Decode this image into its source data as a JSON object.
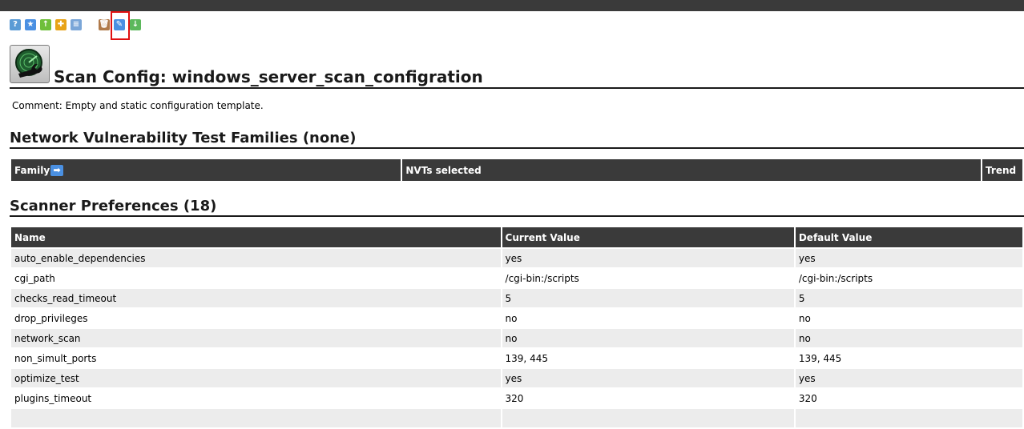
{
  "toolbar": {
    "icons": [
      {
        "name": "help-icon",
        "glyph": "?",
        "color": "#5b9bd5"
      },
      {
        "name": "star-icon",
        "glyph": "★",
        "color": "#4a90e2"
      },
      {
        "name": "up-arrow-icon",
        "glyph": "↑",
        "color": "#6fbf3a"
      },
      {
        "name": "new-config-icon",
        "glyph": "✚",
        "color": "#e8a317"
      },
      {
        "name": "list-icon",
        "glyph": "≡",
        "color": "#7aa6d8"
      },
      {
        "name": "trashcan-icon",
        "glyph": "🗑",
        "color": "#b07a4a"
      },
      {
        "name": "edit-icon",
        "glyph": "✎",
        "color": "#4a90e2"
      },
      {
        "name": "download-icon",
        "glyph": "↓",
        "color": "#5cb85c"
      }
    ]
  },
  "page": {
    "title": "Scan Config: windows_server_scan_configration",
    "comment": "Comment: Empty and static configuration template."
  },
  "families": {
    "heading": "Network Vulnerability Test Families (none)",
    "columns": [
      "Family",
      "NVTs selected",
      "Trend"
    ]
  },
  "scanner_prefs": {
    "heading": "Scanner Preferences (18)",
    "columns": [
      "Name",
      "Current Value",
      "Default Value"
    ],
    "rows": [
      {
        "name": "auto_enable_dependencies",
        "current": "yes",
        "default": "yes"
      },
      {
        "name": "cgi_path",
        "current": "/cgi-bin:/scripts",
        "default": "/cgi-bin:/scripts"
      },
      {
        "name": "checks_read_timeout",
        "current": "5",
        "default": "5"
      },
      {
        "name": "drop_privileges",
        "current": "no",
        "default": "no"
      },
      {
        "name": "network_scan",
        "current": "no",
        "default": "no"
      },
      {
        "name": "non_simult_ports",
        "current": "139, 445",
        "default": "139, 445"
      },
      {
        "name": "optimize_test",
        "current": "yes",
        "default": "yes"
      },
      {
        "name": "plugins_timeout",
        "current": "320",
        "default": "320"
      },
      {
        "name": "",
        "current": "",
        "default": ""
      }
    ]
  }
}
